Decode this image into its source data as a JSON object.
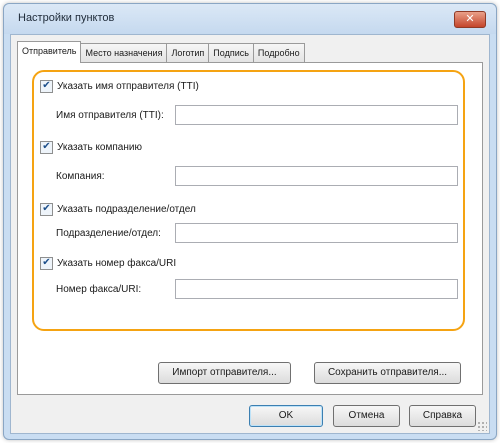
{
  "window": {
    "title": "Настройки пунктов",
    "close_glyph": "✕"
  },
  "tabs": [
    {
      "label": "Отправитель",
      "active": true
    },
    {
      "label": "Место назначения",
      "active": false
    },
    {
      "label": "Логотип",
      "active": false
    },
    {
      "label": "Подпись",
      "active": false
    },
    {
      "label": "Подробно",
      "active": false
    }
  ],
  "sender": {
    "name_check": {
      "label": "Указать имя отправителя (TTI)",
      "checked": true
    },
    "name_field": {
      "label": "Имя отправителя (TTI):",
      "value": ""
    },
    "company_check": {
      "label": "Указать компанию",
      "checked": true
    },
    "company_field": {
      "label": "Компания:",
      "value": ""
    },
    "dept_check": {
      "label": "Указать подразделение/отдел",
      "checked": true
    },
    "dept_field": {
      "label": "Подразделение/отдел:",
      "value": ""
    },
    "fax_check": {
      "label": "Указать номер факса/URI",
      "checked": true
    },
    "fax_field": {
      "label": "Номер факса/URI:",
      "value": ""
    }
  },
  "actions": {
    "import_label": "Импорт отправителя...",
    "save_label": "Сохранить отправителя..."
  },
  "footer": {
    "ok_label": "OK",
    "cancel_label": "Отмена",
    "help_label": "Справка"
  },
  "check_glyph": "✔",
  "colors": {
    "highlight": "#f5a312",
    "window_frame": "#c9ddf2",
    "close_button": "#c4452b"
  }
}
